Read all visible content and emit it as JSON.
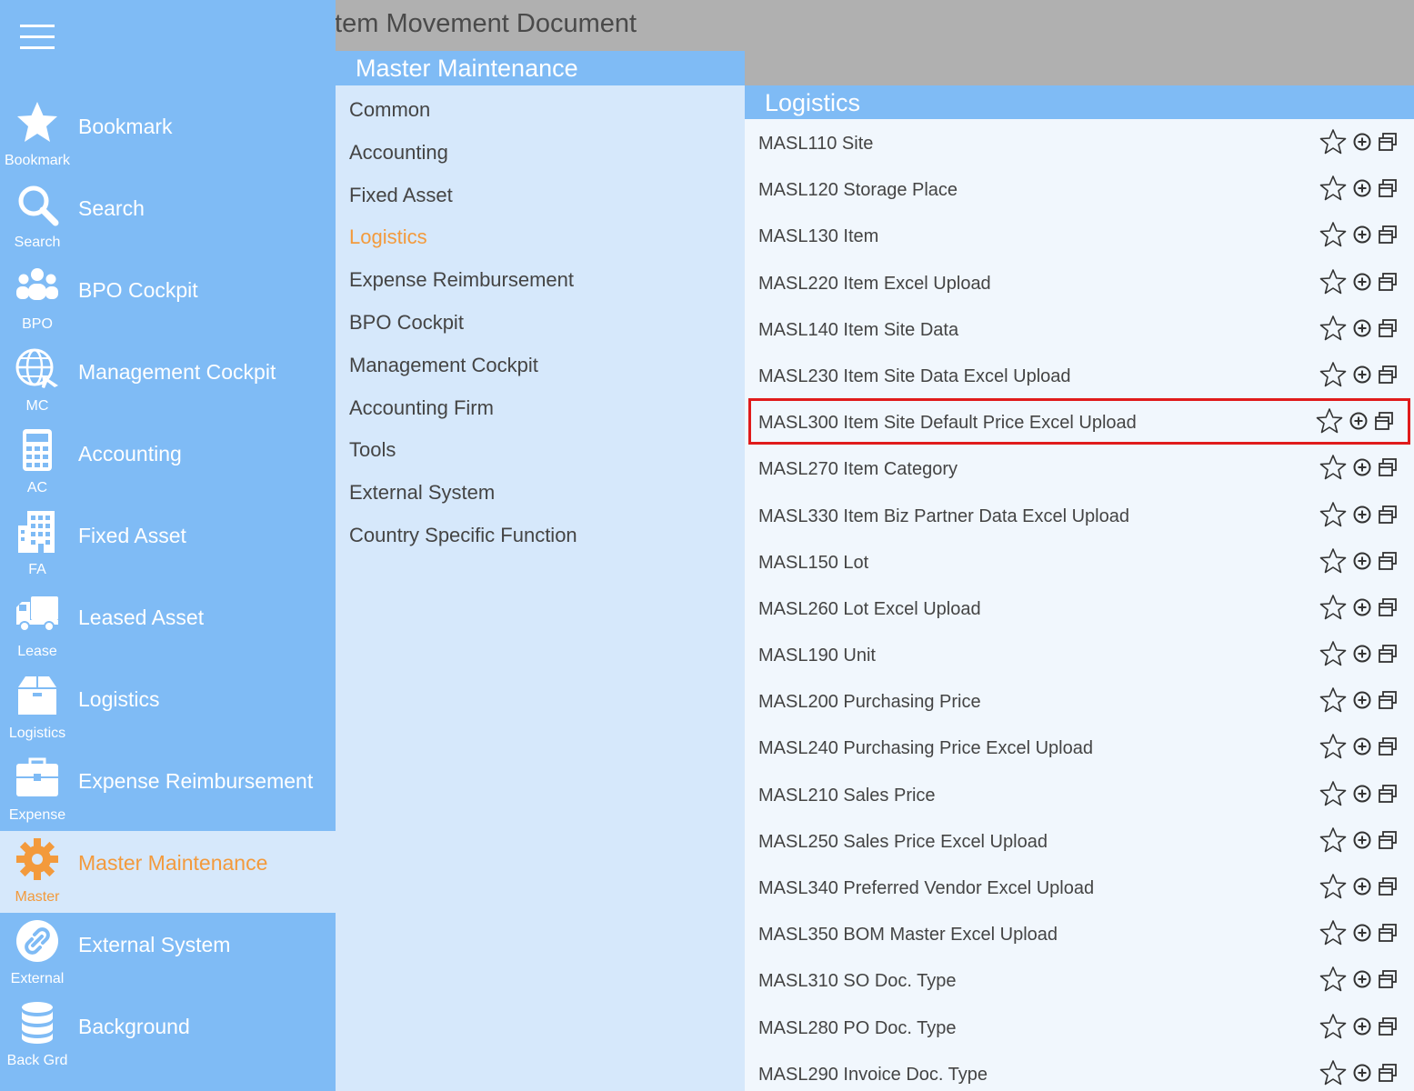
{
  "window": {
    "title": "Item Movement Document"
  },
  "sidebar": {
    "items": [
      {
        "label": "Bookmark",
        "short": "Bookmark",
        "icon": "star-icon"
      },
      {
        "label": "Search",
        "short": "Search",
        "icon": "search-icon"
      },
      {
        "label": "BPO Cockpit",
        "short": "BPO",
        "icon": "users-icon"
      },
      {
        "label": "Management Cockpit",
        "short": "MC",
        "icon": "globe-plane-icon"
      },
      {
        "label": "Accounting",
        "short": "AC",
        "icon": "calculator-icon"
      },
      {
        "label": "Fixed Asset",
        "short": "FA",
        "icon": "building-icon"
      },
      {
        "label": "Leased Asset",
        "short": "Lease",
        "icon": "truck-icon"
      },
      {
        "label": "Logistics",
        "short": "Logistics",
        "icon": "box-icon"
      },
      {
        "label": "Expense Reimbursement",
        "short": "Expense",
        "icon": "briefcase-icon"
      },
      {
        "label": "Master Maintenance",
        "short": "Master",
        "icon": "gear-icon",
        "active": true
      },
      {
        "label": "External System",
        "short": "External",
        "icon": "link-icon"
      },
      {
        "label": "Background",
        "short": "Back Grd",
        "icon": "database-icon"
      }
    ]
  },
  "middle": {
    "title": "Master Maintenance",
    "items": [
      "Common",
      "Accounting",
      "Fixed Asset",
      "Logistics",
      "Expense Reimbursement",
      "BPO Cockpit",
      "Management Cockpit",
      "Accounting Firm",
      "Tools",
      "External System",
      "Country Specific Function"
    ],
    "active": "Logistics"
  },
  "right": {
    "title": "Logistics",
    "highlighted": "MASL300 Item Site Default Price Excel Upload",
    "items": [
      "MASL110 Site",
      "MASL120 Storage Place",
      "MASL130 Item",
      "MASL220 Item Excel Upload",
      "MASL140 Item Site Data",
      "MASL230 Item Site Data Excel Upload",
      "MASL300 Item Site Default Price Excel Upload",
      "MASL270 Item Category",
      "MASL330 Item Biz Partner Data Excel Upload",
      "MASL150 Lot",
      "MASL260 Lot Excel Upload",
      "MASL190 Unit",
      "MASL200 Purchasing Price",
      "MASL240 Purchasing Price Excel Upload",
      "MASL210 Sales Price",
      "MASL250 Sales Price Excel Upload",
      "MASL340 Preferred Vendor Excel Upload",
      "MASL350 BOM Master Excel Upload",
      "MASL310 SO Doc. Type",
      "MASL280 PO Doc. Type",
      "MASL290 Invoice Doc. Type"
    ]
  },
  "colors": {
    "sidebar": "#7fbbf5",
    "panel": "#d6e8fb",
    "accent": "#f39a3c",
    "highlight_border": "#e01b1b",
    "topbar": "#b0b0b0"
  }
}
